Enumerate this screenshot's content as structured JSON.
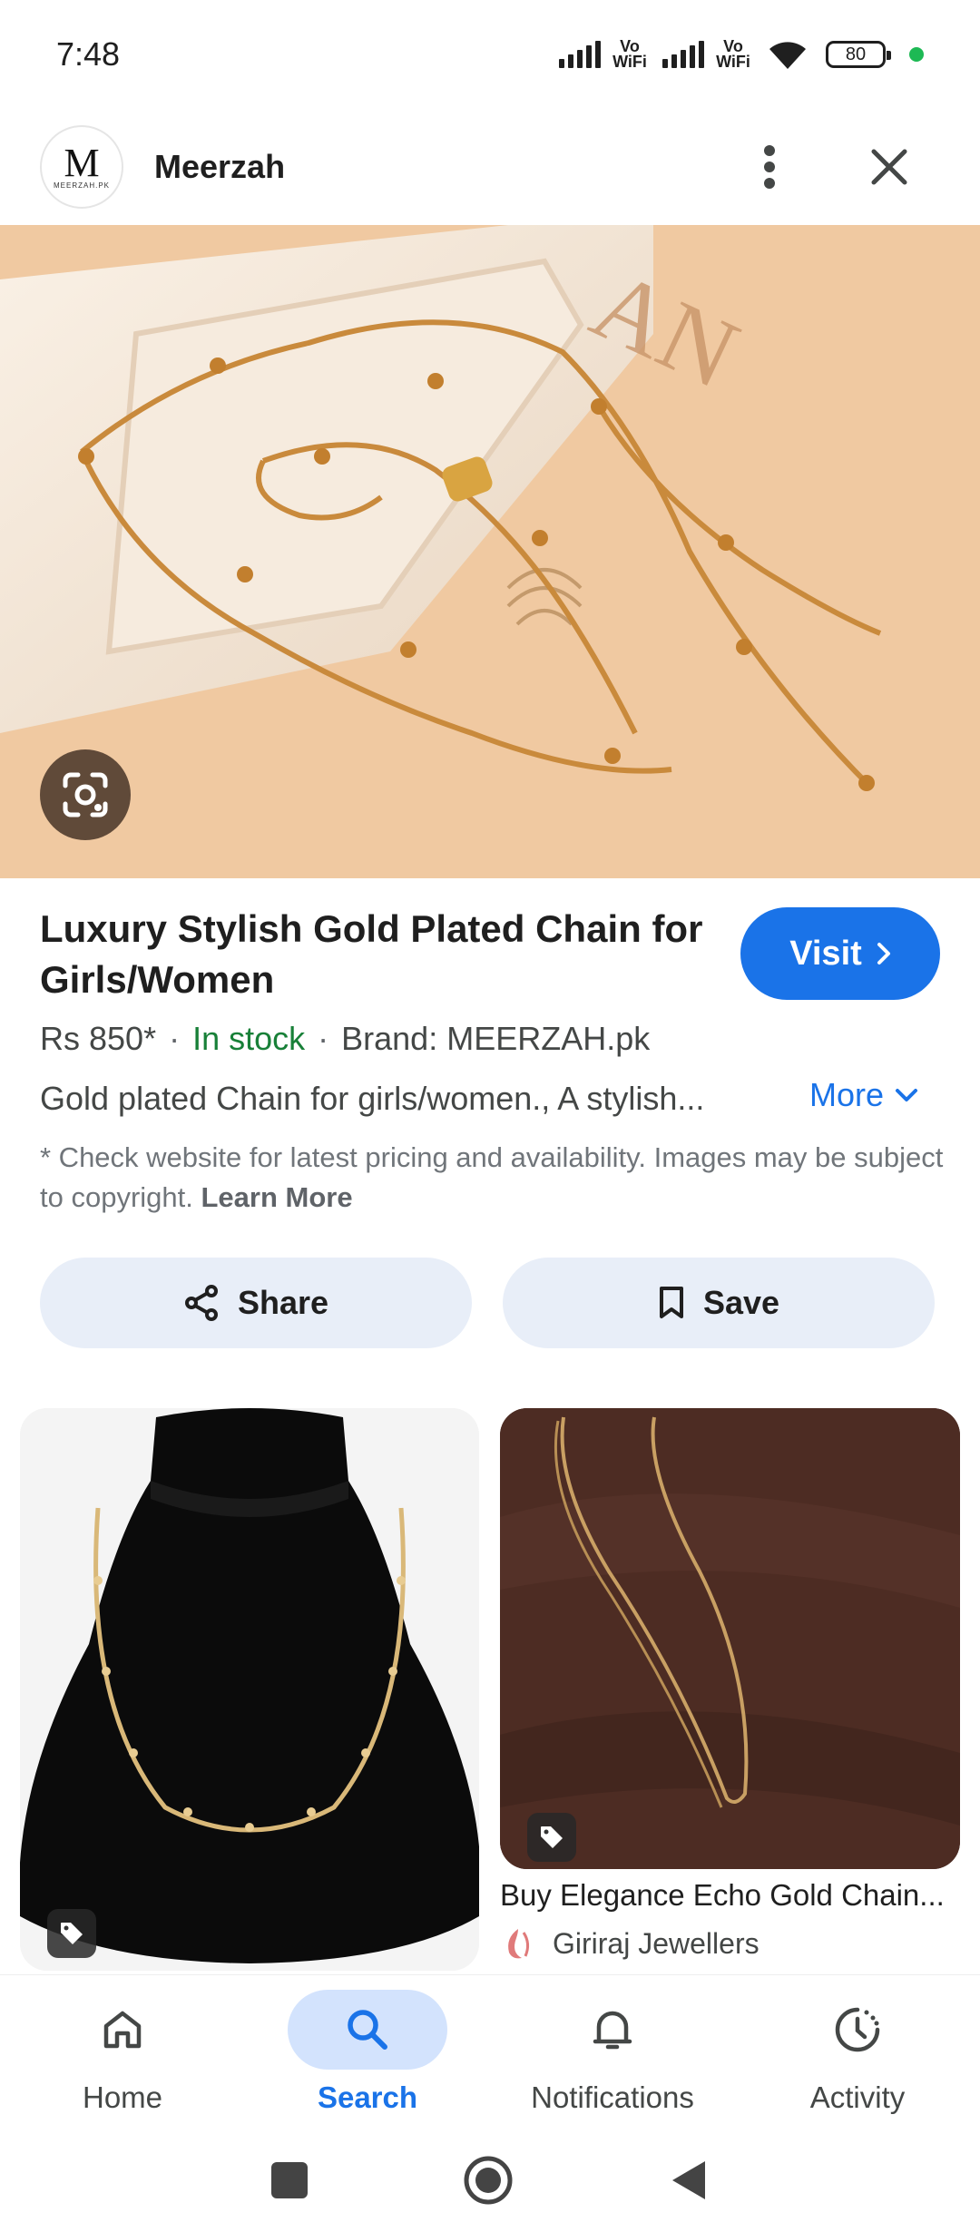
{
  "status_bar": {
    "time": "7:48",
    "network_1": "Vo WiFi",
    "network_2": "Vo WiFi",
    "battery": "80"
  },
  "header": {
    "logo_mark": "M",
    "logo_subtext": "MEERZAH.PK",
    "site_name": "Meerzah"
  },
  "product": {
    "title": "Luxury Stylish Gold Plated Chain for Girls/Women",
    "visit_label": "Visit",
    "price": "Rs 850*",
    "stock": "In stock",
    "brand": "Brand: MEERZAH.pk",
    "description": "Gold plated Chain for girls/women., A stylish...",
    "more_label": "More",
    "disclaimer": "* Check website for latest pricing and availability. Images may be subject to copyright.",
    "learn_more": "Learn More"
  },
  "actions": {
    "share_label": "Share",
    "save_label": "Save"
  },
  "results": [
    {
      "title": "",
      "source": ""
    },
    {
      "title": "Buy Elegance Echo Gold Chain...",
      "source": "Giriraj Jewellers"
    }
  ],
  "bottom_nav": {
    "items": [
      {
        "label": "Home",
        "icon": "home-icon"
      },
      {
        "label": "Search",
        "icon": "search-icon",
        "active": true
      },
      {
        "label": "Notifications",
        "icon": "bell-icon"
      },
      {
        "label": "Activity",
        "icon": "activity-icon"
      }
    ]
  },
  "colors": {
    "accent": "#1a73e8",
    "in_stock": "#188038",
    "active_nav_bg": "#d3e3fd",
    "action_btn_bg": "#e8eef8"
  }
}
